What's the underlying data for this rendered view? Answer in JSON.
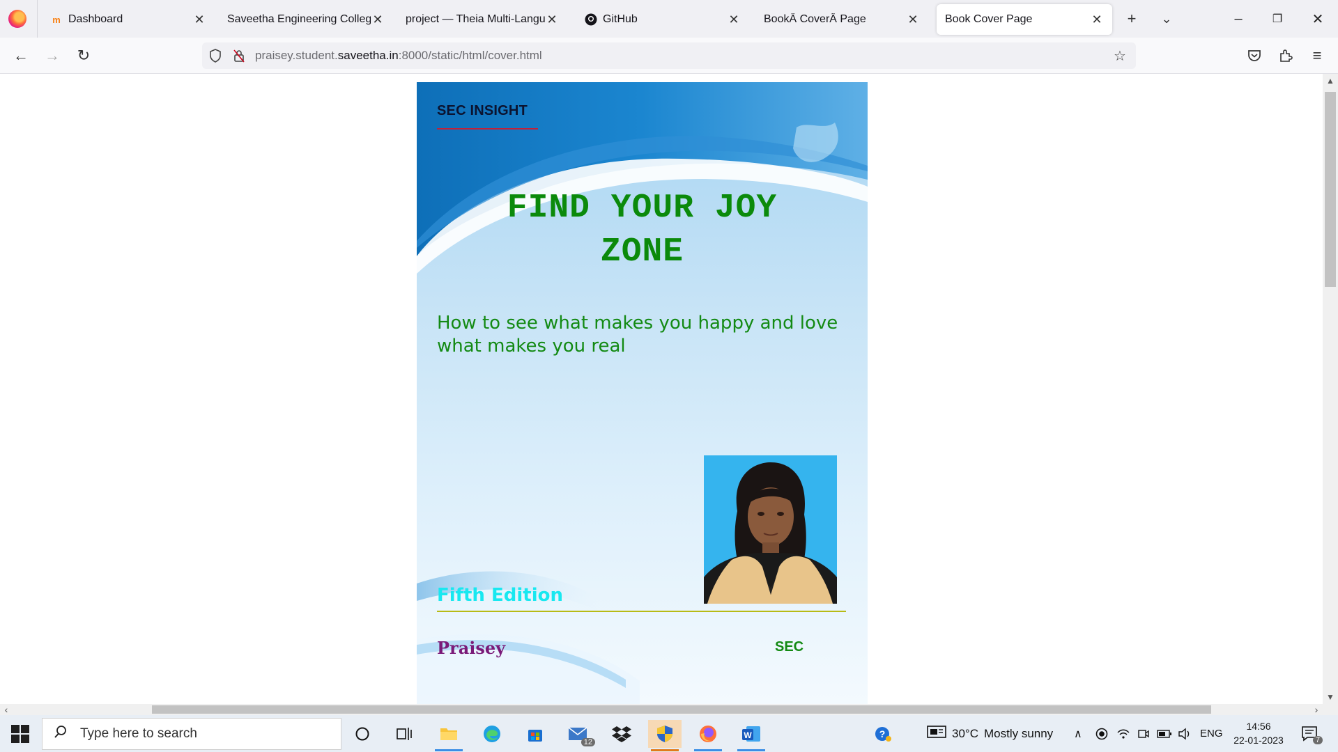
{
  "browser": {
    "tabs": [
      {
        "label": "Dashboard",
        "icon": "moodle-icon",
        "active": false
      },
      {
        "label": "Saveetha Engineering College",
        "icon": "",
        "active": false
      },
      {
        "label": "project — Theia Multi-Language",
        "icon": "",
        "active": false
      },
      {
        "label": "GitHub",
        "icon": "github-icon",
        "active": false
      },
      {
        "label": "BookÂ CoverÂ Page",
        "icon": "",
        "active": false
      },
      {
        "label": "Book Cover Page",
        "icon": "",
        "active": true
      }
    ],
    "url_prefix": "praisey.student.",
    "url_domain": "saveetha.in",
    "url_suffix": ":8000/static/html/cover.html"
  },
  "cover": {
    "series": "SEC INSIGHT",
    "title_line1": "FIND YOUR JOY",
    "title_line2": "ZONE",
    "subtitle": "How to see what makes you happy and love what makes you real",
    "edition": "Fifth Edition",
    "author": "Praisey",
    "publisher": "SEC"
  },
  "taskbar": {
    "search_placeholder": "Type here to search",
    "mail_badge": "12",
    "weather_temp": "30°C",
    "weather_desc": "Mostly sunny",
    "language": "ENG",
    "time": "14:56",
    "date": "22-01-2023",
    "notification_count": "7"
  },
  "colors": {
    "title_green": "#0b8a0b",
    "edition_cyan": "#18e8f0",
    "author_purple": "#7a1a78"
  }
}
